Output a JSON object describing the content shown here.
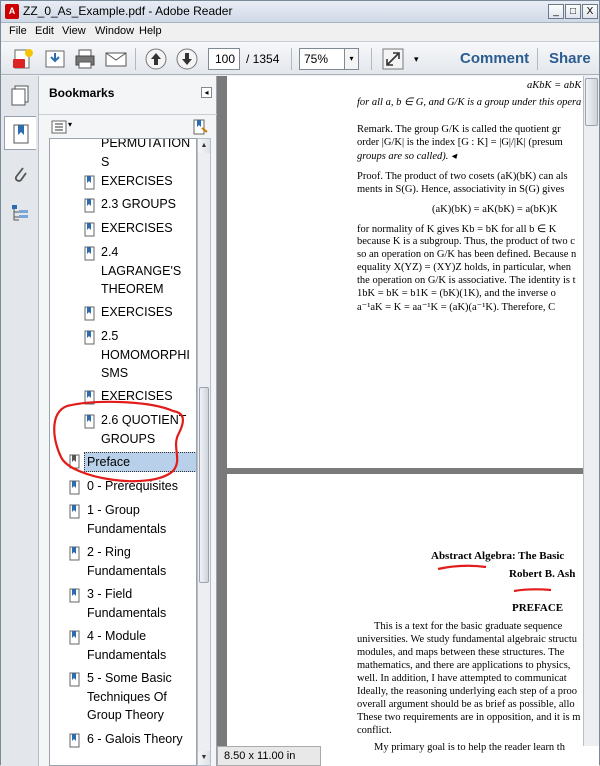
{
  "window": {
    "title": "ZZ_0_As_Example.pdf - Adobe Reader",
    "controls": {
      "minimize": "_",
      "maximize": "□",
      "close": "X"
    }
  },
  "menu": [
    "File",
    "Edit",
    "View",
    "Window",
    "Help"
  ],
  "toolbar": {
    "page_current": "100",
    "page_total": "/ 1354",
    "zoom": "75%",
    "comment_label": "Comment",
    "share_label": "Share",
    "icons": [
      "create-pdf-icon",
      "save-icon",
      "print-icon",
      "email-icon",
      "prev-page-icon",
      "next-page-icon",
      "expand-icon"
    ]
  },
  "sidebar": {
    "title": "Bookmarks",
    "collapse_glyph": "◂",
    "items": [
      {
        "lines": [
          "PERMUTATION",
          "S"
        ],
        "level": 2
      },
      {
        "lines": [
          "EXERCISES"
        ],
        "level": 2
      },
      {
        "lines": [
          "2.3 GROUPS"
        ],
        "level": 2
      },
      {
        "lines": [
          "EXERCISES"
        ],
        "level": 2
      },
      {
        "lines": [
          "2.4",
          "LAGRANGE'S",
          "THEOREM"
        ],
        "level": 2
      },
      {
        "lines": [
          "EXERCISES"
        ],
        "level": 2
      },
      {
        "lines": [
          "2.5",
          "HOMOMORPHI",
          "SMS"
        ],
        "level": 2
      },
      {
        "lines": [
          "EXERCISES"
        ],
        "level": 2
      },
      {
        "lines": [
          "2.6 QUOTIENT",
          "GROUPS"
        ],
        "level": 2
      },
      {
        "lines": [
          "Preface"
        ],
        "level": 1,
        "selected": true
      },
      {
        "lines": [
          "0 - Prerequisites"
        ],
        "level": 1
      },
      {
        "lines": [
          "1 - Group",
          "Fundamentals"
        ],
        "level": 1
      },
      {
        "lines": [
          "2 - Ring",
          "Fundamentals"
        ],
        "level": 1
      },
      {
        "lines": [
          "3 - Field",
          "Fundamentals"
        ],
        "level": 1
      },
      {
        "lines": [
          "4 - Module",
          "Fundamentals"
        ],
        "level": 1
      },
      {
        "lines": [
          "5 - Some Basic",
          "Techniques Of",
          "Group Theory"
        ],
        "level": 1
      },
      {
        "lines": [
          "6 - Galois Theory"
        ],
        "level": 1
      }
    ]
  },
  "page1": {
    "lines": [
      "aKbK = abK",
      "for all a, b ∈ G, and G/K is a group under this opera",
      "Remark.   The group G/K is called the quotient gr",
      "order |G/K| is the index [G : K] = |G|/|K| (presum",
      "groups are so called).   ◂",
      "Proof.   The product of two cosets (aK)(bK) can als",
      "ments in S(G). Hence, associativity in S(G) gives",
      "(aK)(bK) = aK(bK) = a(bK)K",
      "for normality of K gives Kb = bK for all b ∈ K",
      "because K is a subgroup. Thus, the product of two c",
      "so an operation on G/K has been defined. Because n",
      "equality X(YZ) = (XY)Z holds, in particular, when",
      "the operation on G/K is associative. The identity is t",
      "1bK = bK = b1K = (bK)(1K), and the inverse o",
      "a⁻¹aK = K = aa⁻¹K = (aK)(a⁻¹K). Therefore, C"
    ]
  },
  "page2": {
    "title": "Abstract Algebra: The Basic",
    "author": "Robert B. Ash",
    "heading": "PREFACE",
    "lines": [
      "This is a text for the basic graduate sequence",
      "universities. We study fundamental algebraic structu",
      "modules, and maps between these structures. The",
      "mathematics, and there are applications to physics,",
      "well. In addition, I have attempted to communicat",
      "Ideally, the reasoning underlying each step of a proo",
      "overall argument should be as brief as possible, allo",
      "These two requirements are in opposition, and it is m",
      "conflict.",
      "My primary goal is to help the reader learn th"
    ]
  },
  "status": {
    "page_size": "8.50 x 11.00 in"
  },
  "annotation_color": "#e21b1b"
}
